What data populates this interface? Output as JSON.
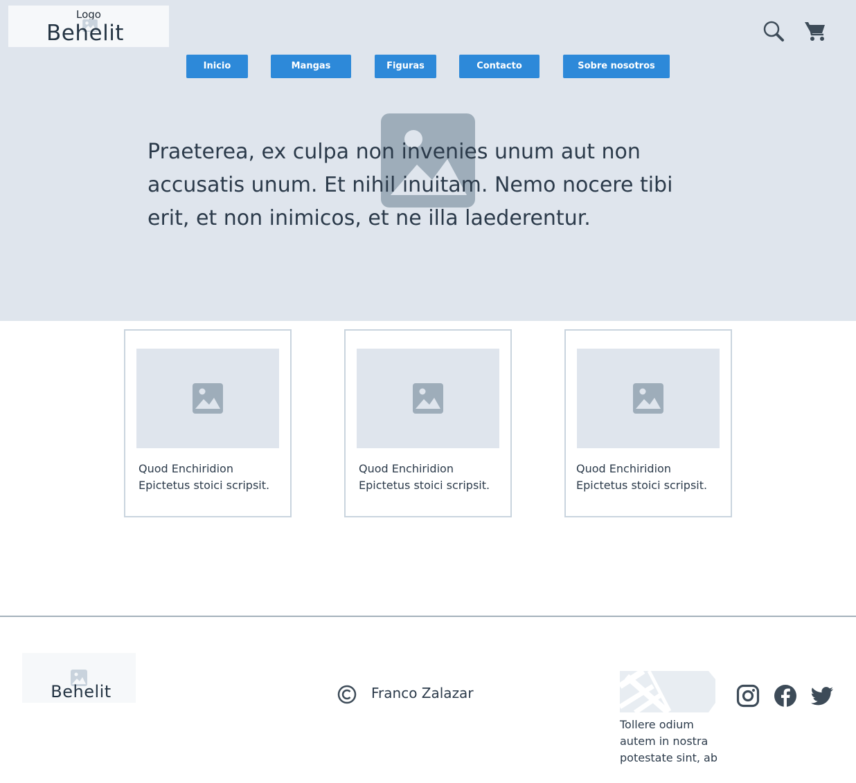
{
  "header": {
    "logo_label": "Logo",
    "logo_name": "Behelit",
    "search_icon": "search-icon",
    "cart_icon": "cart-icon"
  },
  "nav": {
    "items": [
      {
        "label": "Inicio"
      },
      {
        "label": "Mangas"
      },
      {
        "label": "Figuras"
      },
      {
        "label": "Contacto"
      },
      {
        "label": "Sobre nosotros"
      }
    ]
  },
  "hero": {
    "text": "Praeterea, ex culpa non invenies unum aut non accusatis unum. Et nihil inuitam. Nemo nocere tibi erit, et non inimicos, et ne illa laederentur."
  },
  "cards": [
    {
      "text": "Quod Enchiridion Epictetus stoici scripsit."
    },
    {
      "text": "Quod Enchiridion Epictetus stoici scripsit."
    },
    {
      "text": "Quod Enchiridion Epictetus stoici scripsit."
    }
  ],
  "footer": {
    "logo_name": "Behelit",
    "copyright_name": "Franco Zalazar",
    "map_text": "Tollere odium autem in nostra potestate sint, ab",
    "social": [
      "instagram-icon",
      "facebook-icon",
      "twitter-icon"
    ]
  },
  "colors": {
    "hero_bg": "#dfe5ed",
    "nav_button": "#2d89d9",
    "text": "#2b3a4a",
    "placeholder_icon": "#9eadba"
  }
}
